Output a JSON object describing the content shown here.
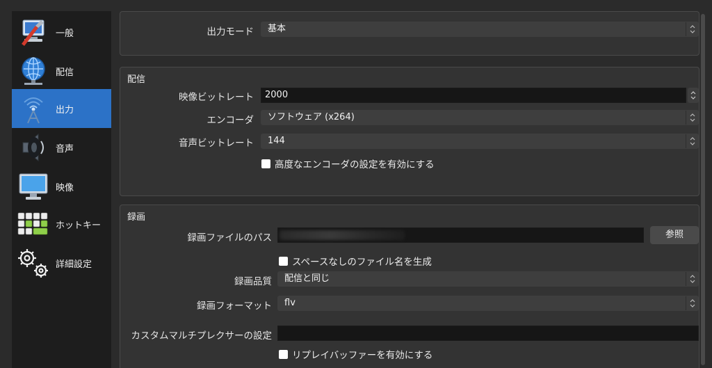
{
  "sidebar": {
    "items": [
      {
        "label": "一般",
        "icon": "wrench-monitor-icon"
      },
      {
        "label": "配信",
        "icon": "globe-network-icon"
      },
      {
        "label": "出力",
        "icon": "broadcast-antenna-icon"
      },
      {
        "label": "音声",
        "icon": "speaker-icon"
      },
      {
        "label": "映像",
        "icon": "monitor-icon"
      },
      {
        "label": "ホットキー",
        "icon": "keyboard-icon"
      },
      {
        "label": "詳細設定",
        "icon": "gears-icon"
      }
    ],
    "active_index": 2,
    "active_color": "#2c72c7"
  },
  "output_mode": {
    "label": "出力モード",
    "value": "基本"
  },
  "streaming": {
    "title": "配信",
    "video_bitrate_label": "映像ビットレート",
    "video_bitrate_value": "2000",
    "encoder_label": "エンコーダ",
    "encoder_value": "ソフトウェア (x264)",
    "audio_bitrate_label": "音声ビットレート",
    "audio_bitrate_value": "144",
    "advanced_encoder_checkbox": "高度なエンコーダの設定を有効にする"
  },
  "recording": {
    "title": "録画",
    "path_label": "録画ファイルのパス",
    "browse_button": "参照",
    "no_space_checkbox": "スペースなしのファイル名を生成",
    "quality_label": "録画品質",
    "quality_value": "配信と同じ",
    "format_label": "録画フォーマット",
    "format_value": "flv",
    "muxer_label": "カスタムマルチプレクサーの設定",
    "muxer_value": "",
    "replay_buffer_checkbox": "リプレイバッファーを有効にする"
  }
}
